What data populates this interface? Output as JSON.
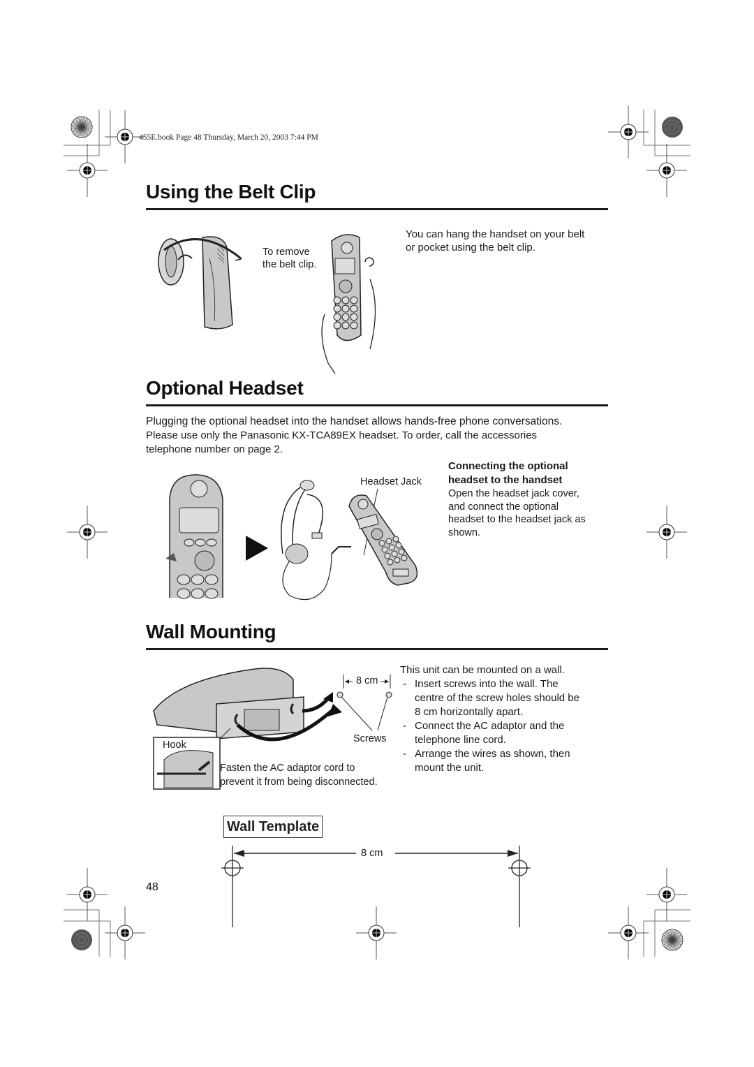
{
  "header": {
    "slug": "455E.book  Page 48  Thursday, March 20, 2003  7:44 PM"
  },
  "sections": {
    "belt_clip": {
      "title": "Using the Belt Clip",
      "figure_caption": [
        "To remove",
        "the belt clip."
      ],
      "description": [
        "You can hang the handset on your belt",
        "or pocket using the belt clip."
      ]
    },
    "headset": {
      "title": "Optional Headset",
      "intro": [
        "Plugging the optional headset into the handset allows hands-free phone conversations.",
        "Please use only the Panasonic KX-TCA89EX headset. To order, call the accessories",
        "telephone number on page 2."
      ],
      "figure_label": "Headset Jack",
      "connect_heading": [
        "Connecting the optional",
        "headset to the handset"
      ],
      "connect_text": [
        "Open the headset jack cover,",
        "and connect the optional",
        "headset to the headset jack as",
        "shown."
      ]
    },
    "wall_mounting": {
      "title": "Wall Mounting",
      "distance_label": "8 cm",
      "screws_label": "Screws",
      "hook_label": "Hook",
      "fasten_caption": [
        "Fasten the AC adaptor cord to",
        "prevent it from being disconnected."
      ],
      "intro": "This unit can be mounted on a wall.",
      "steps": [
        [
          "Insert screws into the wall. The",
          "centre of the screw holes should be",
          "8 cm horizontally apart."
        ],
        [
          "Connect the AC adaptor and the",
          "telephone line cord."
        ],
        [
          "Arrange the wires as shown, then",
          "mount the unit."
        ]
      ]
    },
    "wall_template": {
      "title": "Wall Template",
      "distance_label": "8 cm"
    }
  },
  "footer": {
    "page_number": "48"
  },
  "colors": {
    "text": "#1a1a1a",
    "rule": "#1a1a1a",
    "illustration_fill": "#c8c8c8",
    "registration_mark": "#000000"
  }
}
